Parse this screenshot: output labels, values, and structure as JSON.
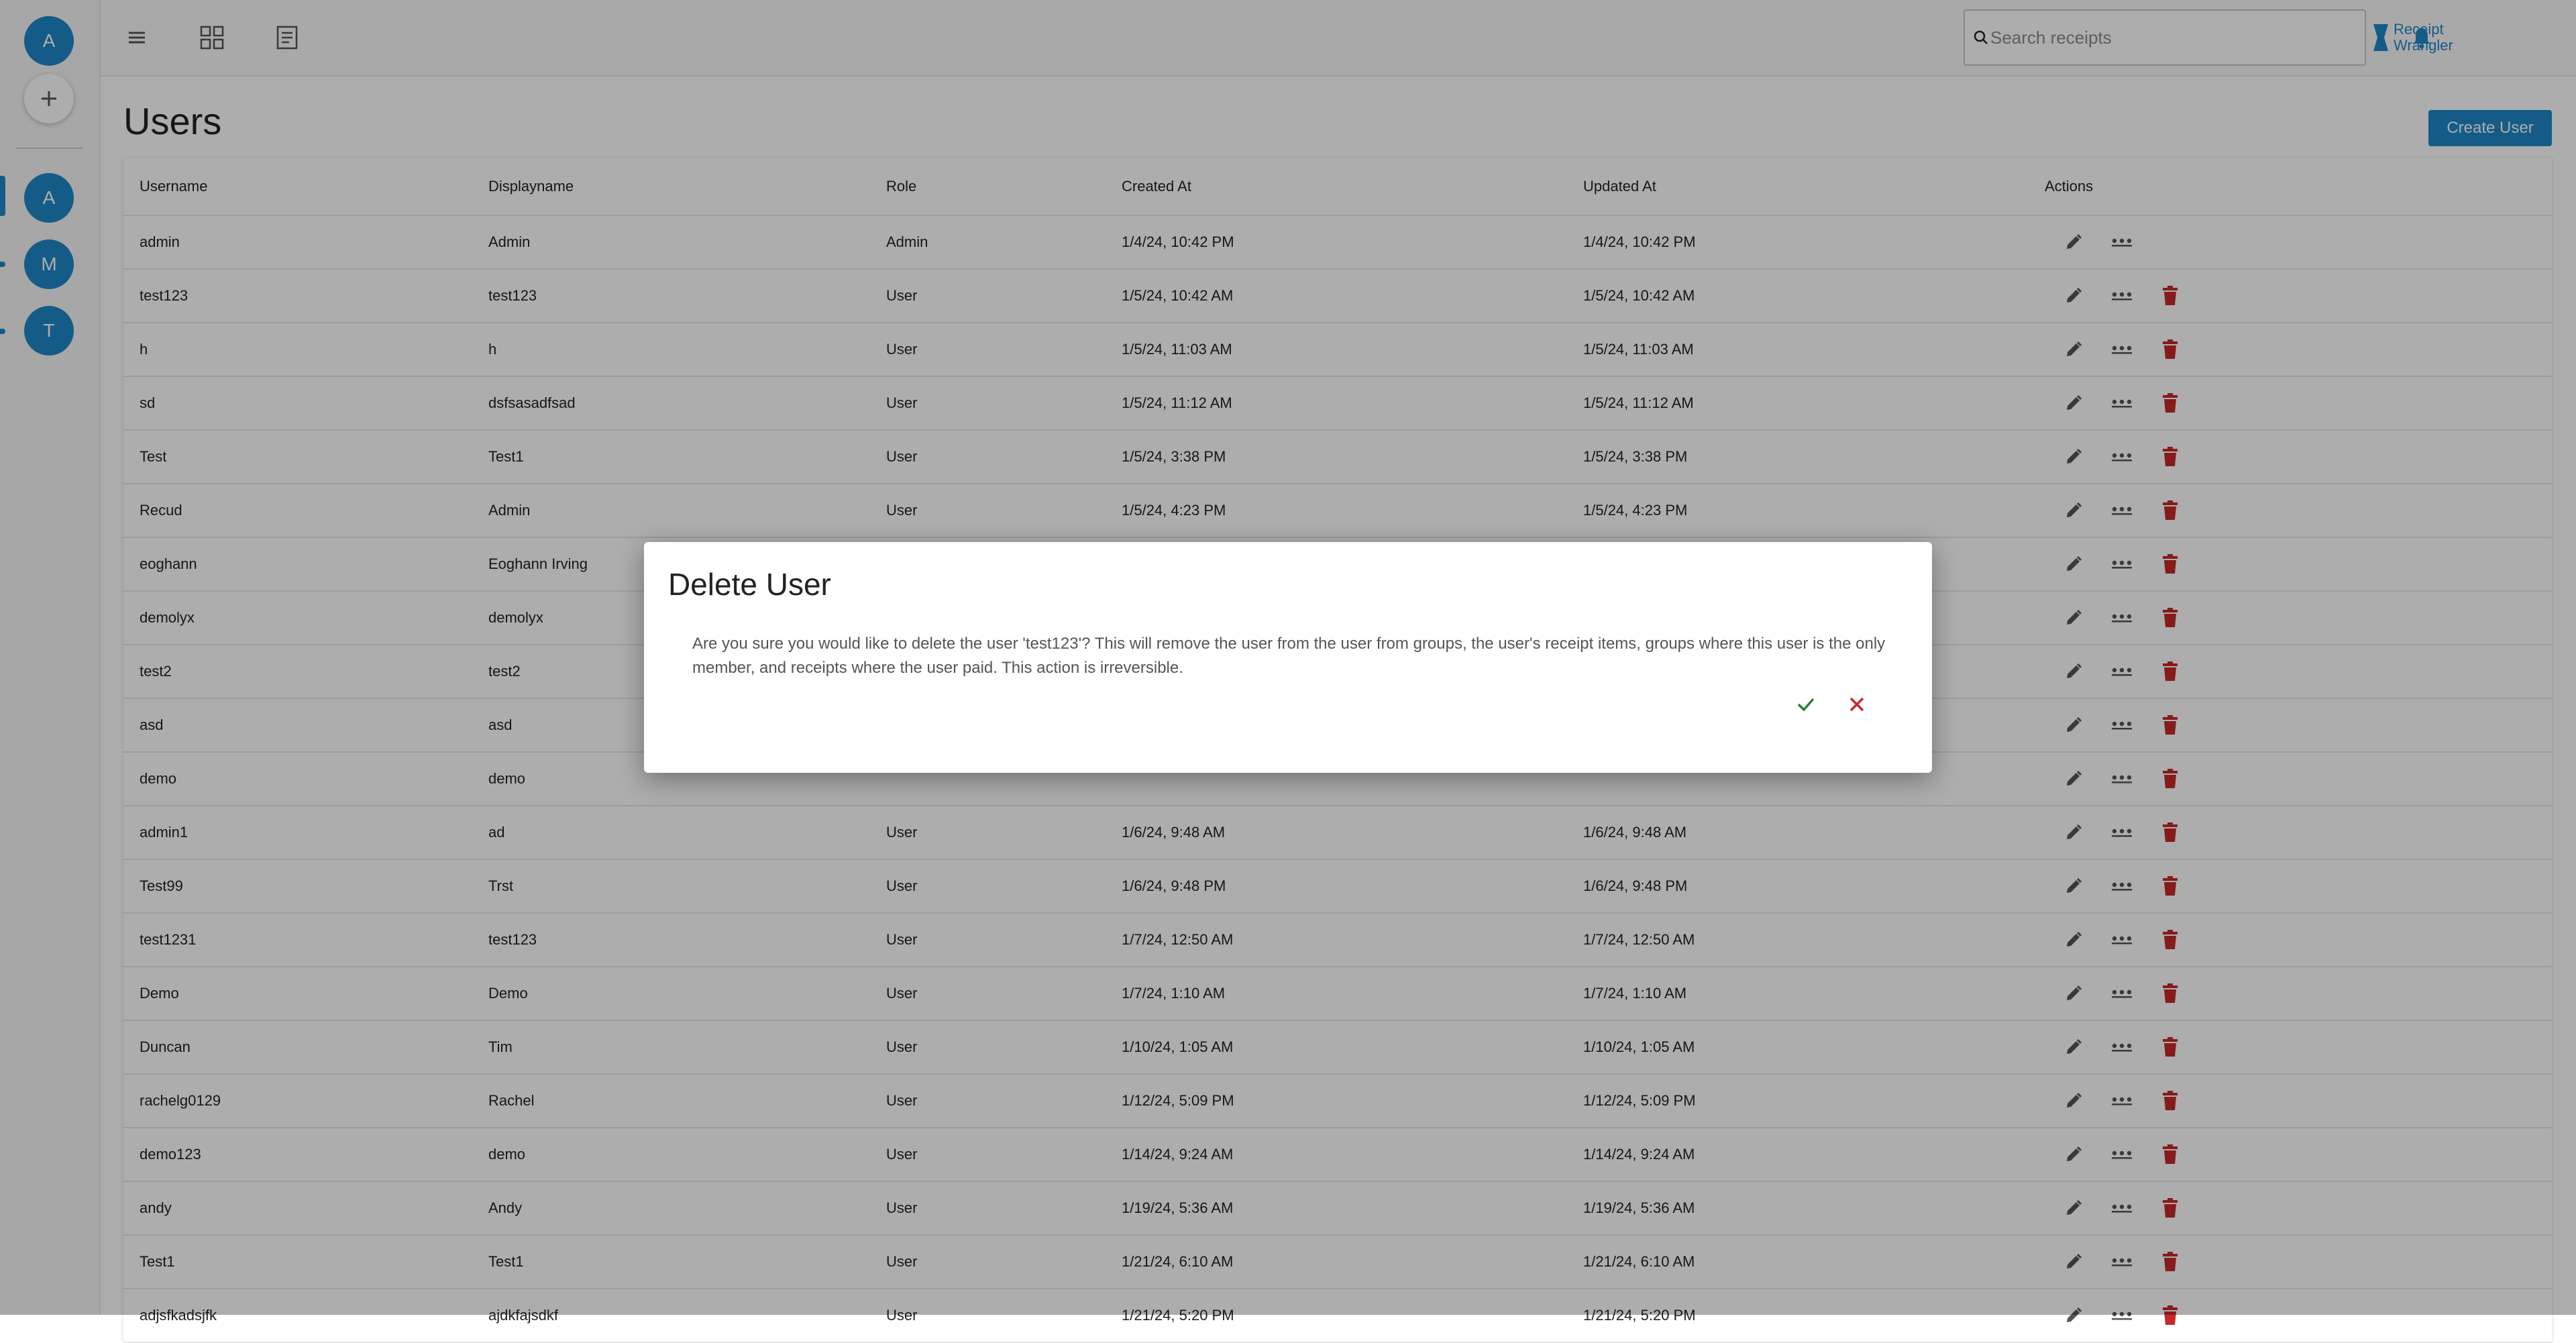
{
  "rail": {
    "current_user_initial": "A",
    "groups": [
      {
        "initial": "A",
        "selected": true
      },
      {
        "initial": "M",
        "selected": false
      },
      {
        "initial": "T",
        "selected": false
      }
    ]
  },
  "topbar": {
    "search_placeholder": "Search receipts",
    "logo_line1": "Receipt",
    "logo_line2": "Wrangler"
  },
  "page": {
    "title": "Users",
    "create_button": "Create User"
  },
  "table": {
    "headers": [
      "Username",
      "Displayname",
      "Role",
      "Created At",
      "Updated At",
      "Actions"
    ],
    "rows": [
      {
        "username": "admin",
        "displayname": "Admin",
        "role": "Admin",
        "created": "1/4/24, 10:42 PM",
        "updated": "1/4/24, 10:42 PM",
        "deletable": false
      },
      {
        "username": "test123",
        "displayname": "test123",
        "role": "User",
        "created": "1/5/24, 10:42 AM",
        "updated": "1/5/24, 10:42 AM",
        "deletable": true
      },
      {
        "username": "h",
        "displayname": "h",
        "role": "User",
        "created": "1/5/24, 11:03 AM",
        "updated": "1/5/24, 11:03 AM",
        "deletable": true
      },
      {
        "username": "sd",
        "displayname": "dsfsasadfsad",
        "role": "User",
        "created": "1/5/24, 11:12 AM",
        "updated": "1/5/24, 11:12 AM",
        "deletable": true
      },
      {
        "username": "Test",
        "displayname": "Test1",
        "role": "User",
        "created": "1/5/24, 3:38 PM",
        "updated": "1/5/24, 3:38 PM",
        "deletable": true
      },
      {
        "username": "Recud",
        "displayname": "Admin",
        "role": "User",
        "created": "1/5/24, 4:23 PM",
        "updated": "1/5/24, 4:23 PM",
        "deletable": true
      },
      {
        "username": "eoghann",
        "displayname": "Eoghann Irving",
        "role": "",
        "created": "",
        "updated": "",
        "deletable": true
      },
      {
        "username": "demolyx",
        "displayname": "demolyx",
        "role": "",
        "created": "",
        "updated": "",
        "deletable": true
      },
      {
        "username": "test2",
        "displayname": "test2",
        "role": "",
        "created": "",
        "updated": "",
        "deletable": true
      },
      {
        "username": "asd",
        "displayname": "asd",
        "role": "",
        "created": "",
        "updated": "",
        "deletable": true
      },
      {
        "username": "demo",
        "displayname": "demo",
        "role": "",
        "created": "",
        "updated": "",
        "deletable": true
      },
      {
        "username": "admin1",
        "displayname": "ad",
        "role": "User",
        "created": "1/6/24, 9:48 AM",
        "updated": "1/6/24, 9:48 AM",
        "deletable": true
      },
      {
        "username": "Test99",
        "displayname": "Trst",
        "role": "User",
        "created": "1/6/24, 9:48 PM",
        "updated": "1/6/24, 9:48 PM",
        "deletable": true
      },
      {
        "username": "test1231",
        "displayname": "test123",
        "role": "User",
        "created": "1/7/24, 12:50 AM",
        "updated": "1/7/24, 12:50 AM",
        "deletable": true
      },
      {
        "username": "Demo",
        "displayname": "Demo",
        "role": "User",
        "created": "1/7/24, 1:10 AM",
        "updated": "1/7/24, 1:10 AM",
        "deletable": true
      },
      {
        "username": "Duncan",
        "displayname": "Tim",
        "role": "User",
        "created": "1/10/24, 1:05 AM",
        "updated": "1/10/24, 1:05 AM",
        "deletable": true
      },
      {
        "username": "rachelg0129",
        "displayname": "Rachel",
        "role": "User",
        "created": "1/12/24, 5:09 PM",
        "updated": "1/12/24, 5:09 PM",
        "deletable": true
      },
      {
        "username": "demo123",
        "displayname": "demo",
        "role": "User",
        "created": "1/14/24, 9:24 AM",
        "updated": "1/14/24, 9:24 AM",
        "deletable": true
      },
      {
        "username": "andy",
        "displayname": "Andy",
        "role": "User",
        "created": "1/19/24, 5:36 AM",
        "updated": "1/19/24, 5:36 AM",
        "deletable": true
      },
      {
        "username": "Test1",
        "displayname": "Test1",
        "role": "User",
        "created": "1/21/24, 6:10 AM",
        "updated": "1/21/24, 6:10 AM",
        "deletable": true
      },
      {
        "username": "adjsfkadsjfk",
        "displayname": "ajdkfajsdkf",
        "role": "User",
        "created": "1/21/24, 5:20 PM",
        "updated": "1/21/24, 5:20 PM",
        "deletable": true
      }
    ]
  },
  "dialog": {
    "title": "Delete User",
    "body": "Are you sure you would like to delete the user 'test123'? This will remove the user from the user from groups, the user's receipt items, groups where this user is the only member, and receipts where the user paid. This action is irreversible."
  },
  "icons": {
    "menu": "menu-icon",
    "dashboard": "dashboard-icon",
    "receipts": "receipts-icon",
    "search": "search-icon",
    "notifications": "bell-icon",
    "edit": "pencil-icon",
    "more": "more-horizontal-icon",
    "delete": "trash-icon",
    "confirm": "check-icon",
    "cancel": "close-icon"
  },
  "colors": {
    "primary": "#1e88c8",
    "danger": "#c62828",
    "confirm": "#2e7d32",
    "overlay": "rgba(0,0,0,0.32)"
  }
}
